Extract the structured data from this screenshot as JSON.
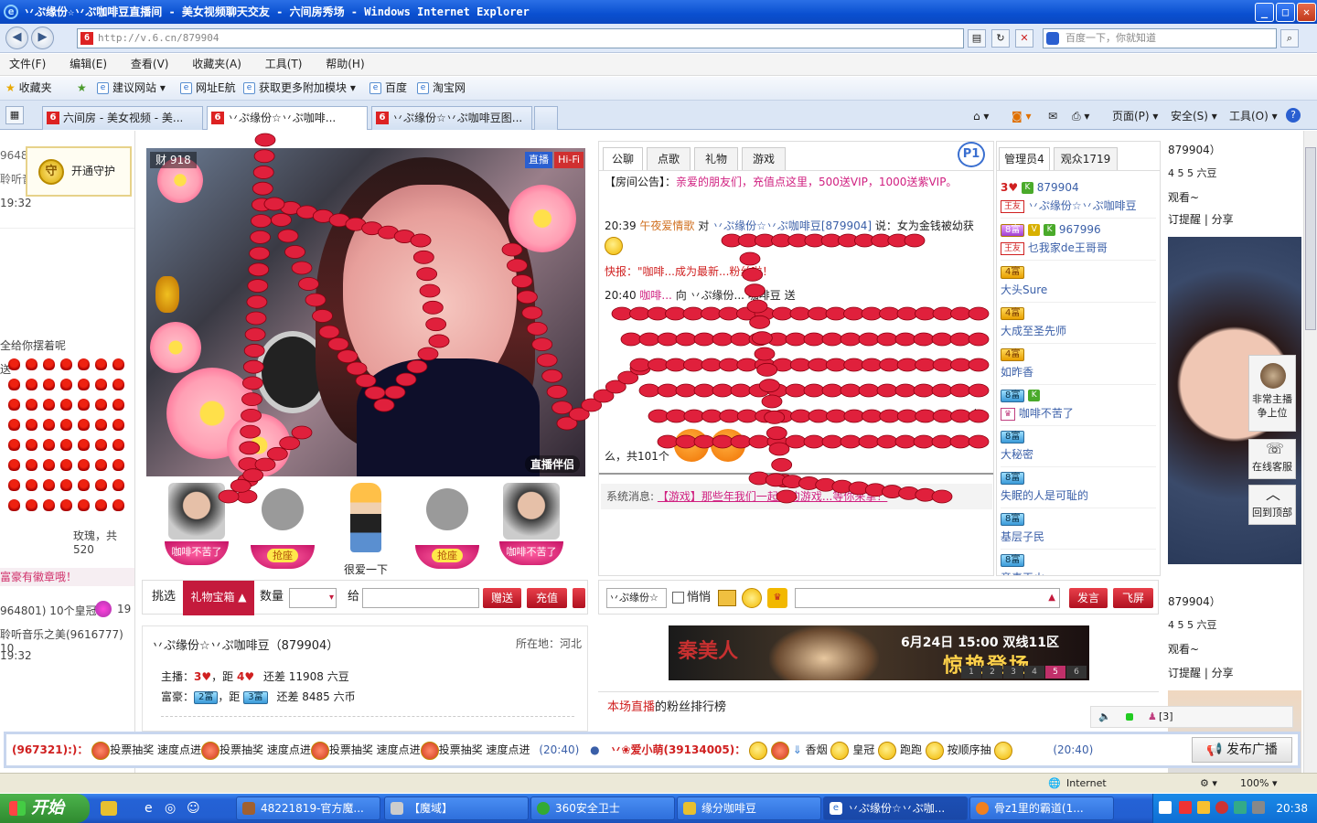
{
  "window": {
    "title": "丷ぷ缘份☆丷ぷ咖啡豆直播间 - 美女视频聊天交友 - 六间房秀场 - Windows Internet Explorer",
    "buttons": {
      "min": "_",
      "max": "□",
      "close": "✕"
    }
  },
  "address": {
    "url": "http://v.6.cn/879904",
    "search_placeholder": "百度一下，你就知道"
  },
  "menu": [
    "文件(F)",
    "编辑(E)",
    "查看(V)",
    "收藏夹(A)",
    "工具(T)",
    "帮助(H)"
  ],
  "favorites": {
    "label": "收藏夹",
    "items": [
      "建议网站 ▾",
      "网址E航",
      "获取更多附加模块 ▾",
      "百度",
      "淘宝网"
    ]
  },
  "tabs": [
    {
      "label": "六间房 - 美女视频 - 美..."
    },
    {
      "label": "丷ぷ缘份☆丷ぷ咖啡..."
    },
    {
      "label": "丷ぷ缘份☆丷ぷ咖啡豆图..."
    }
  ],
  "commandbar": {
    "page": "页面(P) ▾",
    "safety": "安全(S) ▾",
    "tools": "工具(O) ▾",
    "help": "?"
  },
  "left": {
    "guard_label": "开通守护",
    "lines": [
      "9648",
      "聆听音",
      "19:32",
      "全给你摆着呢",
      "送",
      "玫瑰，共520",
      "富豪有徽章哦！",
      "964801) 10个皇冠",
      "聆听音乐之美(9616777) 10",
      "19:32"
    ],
    "line_19": "19"
  },
  "video": {
    "wealth_badge": "财 918",
    "live": "直播",
    "hifi": "Hi-Fi",
    "live_partner": "直播伴侣"
  },
  "seats": [
    {
      "label": "咖啡不苦了"
    },
    {
      "label": "抢座"
    },
    {
      "label": "很爱一下"
    },
    {
      "label": "抢座"
    },
    {
      "label": "咖啡不苦了"
    }
  ],
  "gift": {
    "pick": "挑选",
    "box": "礼物宝箱",
    "qty_label": "数量",
    "to_label": "给",
    "send": "赠送",
    "recharge": "充值"
  },
  "host": {
    "name": "丷ぷ缘份☆丷ぷ咖啡豆（879904）",
    "location": "所在地：河北",
    "anchor_label": "主播：",
    "anchor_level": "3",
    "anchor_next": "4",
    "anchor_gap": "还差 11908 六豆",
    "rich_label": "富豪：",
    "rich_level": "2富",
    "rich_next": "3富",
    "rich_gap": "还差 8485 六币",
    "distance": "，距"
  },
  "chat": {
    "tabs": [
      "公聊",
      "点歌",
      "礼物",
      "游戏"
    ],
    "p1": "P1",
    "notice_prefix": "【房间公告】：",
    "notice": "亲爱的朋友们，充值点这里，500送VIP，1000送紫VIP。",
    "line1_time": "20:39",
    "line1_user": "午夜爱情歌",
    "line1_to": "对",
    "line1_target": "丷ぷ缘份☆丷ぷ咖啡豆[879904]",
    "line1_text": "说：女为金钱被幼获",
    "line2": "快报：\"咖啡...成为最新...粉丝啦！",
    "line3_time": "20:40",
    "line3_user": "咖啡...",
    "line3_text": "向 丷ぷ缘份... 咖啡豆 送",
    "line4": "么",
    "line5": "么，共101个",
    "sys_label": "系统消息:",
    "sys_text": "【游戏】那些年我们一起玩的游戏...等你来拿！"
  },
  "userlist": {
    "tabs": [
      "管理员4",
      "观众1719"
    ],
    "items": [
      {
        "level": "3",
        "num": "879904",
        "badge": "王友",
        "name": "丷ぷ缘份☆丷ぷ咖啡豆"
      },
      {
        "level": "8富",
        "num": "967996",
        "badge": "王友",
        "name": "乜我家de王哥哥"
      },
      {
        "level": "4富",
        "name": "大头Sure"
      },
      {
        "level": "4富",
        "name": "大成至圣先师"
      },
      {
        "level": "4富",
        "name": "如昨香"
      },
      {
        "level": "8富",
        "name": "咖啡不苦了"
      },
      {
        "level": "8富",
        "name": "大秘密"
      },
      {
        "level": "8富",
        "name": "失眠的人是可耻的"
      },
      {
        "level": "8富",
        "name": "基层子民"
      },
      {
        "level": "8富",
        "name": "竞毒天火"
      }
    ]
  },
  "send": {
    "who": "丷ぷ缘份☆",
    "whisper": "悄悄",
    "submit": "发言",
    "fly": "飞屏"
  },
  "banner": {
    "logo": "秦美人",
    "date": "6月24日 15:00 双线11区",
    "big": "惊艳登场",
    "pages": [
      "1",
      "2",
      "3",
      "4",
      "5",
      "6"
    ],
    "active_page": "5"
  },
  "fanrank": {
    "highlight": "本场直播",
    "rest": "的粉丝排行榜"
  },
  "right": {
    "lines1": [
      "879904）",
      "4 5 5  六豆",
      "观看~",
      "订提醒  |  分享"
    ],
    "lines2": [
      "879904）",
      "4 5 5  六豆",
      "观看~",
      "订提醒  |  分享"
    ]
  },
  "sidebuttons": {
    "promote": "非常主播 争上位",
    "service": "在线客服",
    "top": "回到顶部"
  },
  "controls": {
    "count": "[3]"
  },
  "broadcast": {
    "seg1_user": "(967321):)：",
    "vote": "投票抽奖",
    "fast": "速度点进",
    "time1": "(20:40)",
    "seg2_user": "丷❀爱小萌(39134005)：",
    "smoke": "香烟",
    "crown": "皇冠",
    "run": "跑跑",
    "order": "按顺序抽",
    "time2": "(20:40)",
    "publish": "发布广播"
  },
  "status": {
    "zone": "Internet",
    "zoom": "100% ▾"
  },
  "taskbar": {
    "start": "开始",
    "tasks": [
      "48221819-官方魔...",
      "【魔域】",
      "360安全卫士",
      "缘分咖啡豆",
      "丷ぷ缘份☆丷ぷ咖...",
      "骨z1里的霸道(1..."
    ],
    "clock": "20:38"
  },
  "colors": {
    "accent": "#c41a3c",
    "xp_blue": "#2462d6",
    "kiss": "#e0203c"
  }
}
